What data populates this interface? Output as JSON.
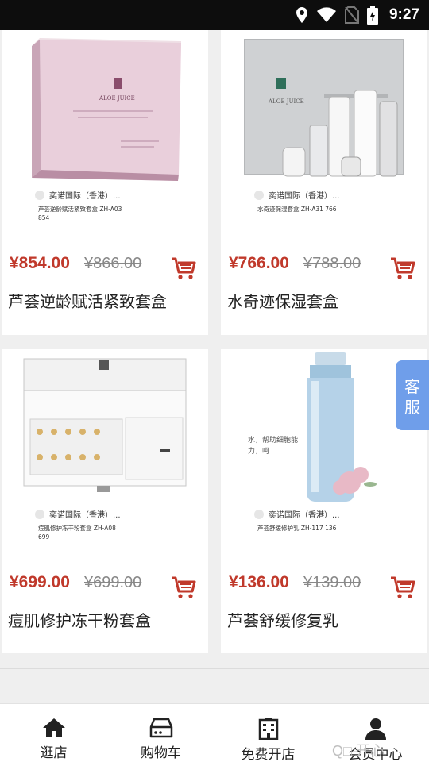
{
  "status_bar": {
    "time": "9:27"
  },
  "products": [
    {
      "seller": "奕诺国际（香港）...",
      "code": "芦荟逆龄赋活紧致套盒 ZH-A03 854",
      "price": "¥854.00",
      "old_price": "¥866.00",
      "title": "芦荟逆龄赋活紧致套盒",
      "brand": "ALOE JUICE"
    },
    {
      "seller": "奕诺国际（香港）...",
      "code": "水奇迹保湿套盒 ZH-A31 766",
      "price": "¥766.00",
      "old_price": "¥788.00",
      "title": "水奇迹保湿套盒",
      "brand": "ALOE JUICE"
    },
    {
      "seller": "奕诺国际（香港）...",
      "code": "痘肌修护冻干粉套盒 ZH-A08 699",
      "price": "¥699.00",
      "old_price": "¥699.00",
      "title": "痘肌修护冻干粉套盒"
    },
    {
      "seller": "奕诺国际（香港）...",
      "code": "芦荟舒缓修护乳 ZH-117 136",
      "price": "¥136.00",
      "old_price": "¥139.00",
      "title": "芦荟舒缓修复乳",
      "note": "水，帮助细胞能力，呵"
    }
  ],
  "customer_service": "客服",
  "tabs": [
    {
      "label": "逛店",
      "icon": "home-icon"
    },
    {
      "label": "购物车",
      "icon": "cart-box-icon"
    },
    {
      "label": "免费开店",
      "icon": "building-icon"
    },
    {
      "label": "会员中心",
      "icon": "user-icon"
    }
  ],
  "watermark": "Q□ 开心",
  "colors": {
    "price": "#c0392b",
    "service_tab": "#6f9eea",
    "status_bar": "#0d0d0d"
  }
}
